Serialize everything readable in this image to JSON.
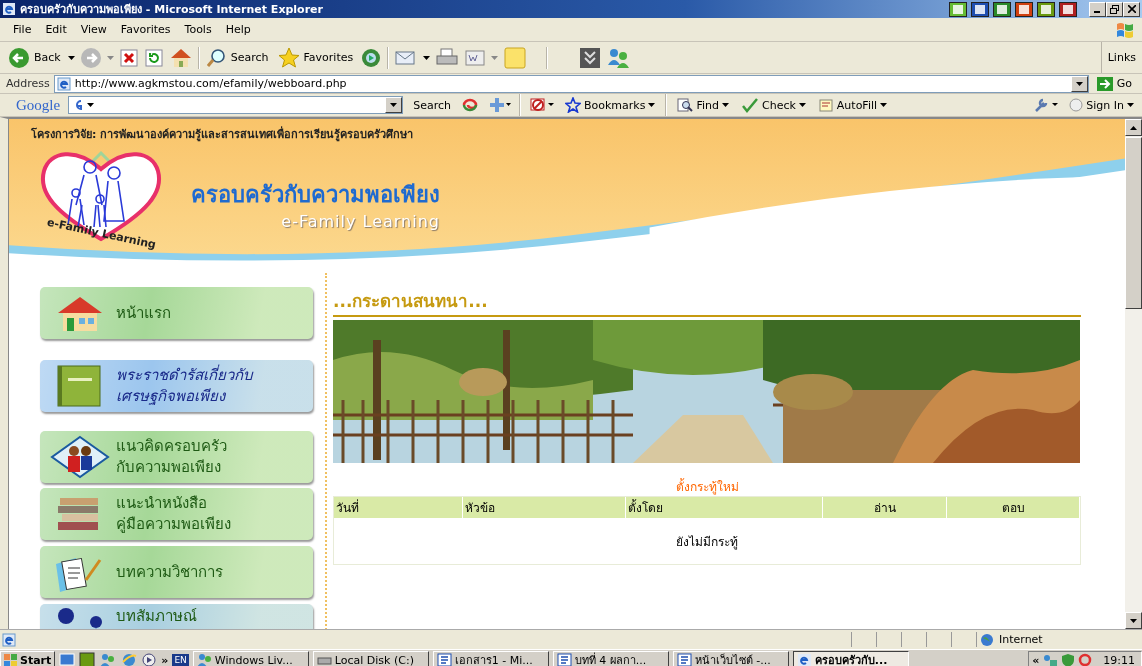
{
  "window": {
    "title": "ครอบครัวกับความพอเพียง - Microsoft Internet Explorer"
  },
  "menu": [
    "File",
    "Edit",
    "View",
    "Favorites",
    "Tools",
    "Help"
  ],
  "toolbar": {
    "back": "Back",
    "search": "Search",
    "favorites": "Favorites"
  },
  "address_bar": {
    "label": "Address",
    "url": "http://www.agkmstou.com/efamily/webboard.php",
    "go": "Go",
    "links": "Links"
  },
  "google_bar": {
    "logo": "Google",
    "search": "Search",
    "bookmarks": "Bookmarks",
    "find": "Find",
    "check": "Check",
    "autofill": "AutoFill",
    "sign_in": "Sign In"
  },
  "header": {
    "project": "โครงการวิจัย: การพัฒนาองค์ความรู้และสารสนเทศเพื่อการเรียนรู้ครอบครัวศึกษา",
    "logo_text": "e-Family Learning",
    "title": "ครอบครัวกับความพอเพียง",
    "subtitle": "e-Family Learning"
  },
  "nav": [
    {
      "kind": "home",
      "lines": [
        "หน้าแรก"
      ],
      "color": "#a6d898"
    },
    {
      "kind": "book",
      "lines": [
        "พระราชดำรัสเกี่ยวกับ",
        "เศรษฐกิจพอเพียง"
      ],
      "color": "#9cc6ee"
    },
    {
      "kind": "family",
      "lines": [
        "แนวคิดครอบครัว",
        "กับความพอเพียง"
      ],
      "color": "#a6d898"
    },
    {
      "kind": "books",
      "lines": [
        "แนะนำหนังสือ",
        "คู่มือความพอเพียง"
      ],
      "color": "#a6d898"
    },
    {
      "kind": "article",
      "lines": [
        "บทความวิชาการ"
      ],
      "color": "#a6d898"
    },
    {
      "kind": "interview",
      "lines": [
        "บทสัมภาษณ์"
      ],
      "color": "#a9cfe0"
    }
  ],
  "board": {
    "heading": "...กระดานสนทนา...",
    "new_topic": "ตั้งกระทู้ใหม่",
    "columns": [
      "วันที่",
      "หัวข้อ",
      "ตั้งโดย",
      "อ่าน",
      "ตอบ"
    ],
    "empty": "ยังไม่มีกระทู้"
  },
  "status_bar": {
    "zone": "Internet"
  },
  "taskbar": {
    "start": "Start",
    "quick_more": "»",
    "language": "EN",
    "tasks": [
      {
        "kind": "messenger",
        "label": "Windows Liv...",
        "selected": false
      },
      {
        "kind": "disk",
        "label": "Local Disk (C:)",
        "selected": false
      },
      {
        "kind": "word",
        "label": "เอกสาร1 - Mi...",
        "selected": false
      },
      {
        "kind": "word",
        "label": "บทที่ 4 ผลกา...",
        "selected": false
      },
      {
        "kind": "word",
        "label": "หน้าเว็บไซต์ -...",
        "selected": false
      },
      {
        "kind": "ie",
        "label": "ครอบครัวกับ...",
        "selected": true
      }
    ],
    "tray_more": "«",
    "clock": "19:11"
  }
}
